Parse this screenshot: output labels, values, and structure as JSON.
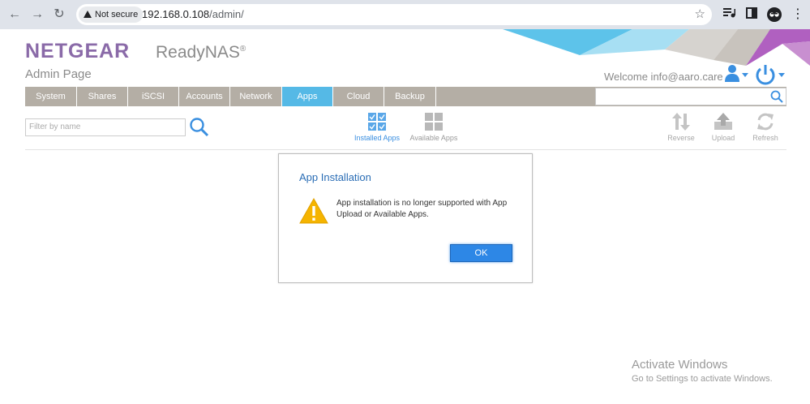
{
  "browser": {
    "back_glyph": "←",
    "forward_glyph": "→",
    "reload_glyph": "↻",
    "security_label": "Not secure",
    "url_host": "192.168.0.108",
    "url_path": "/admin/",
    "star_glyph": "☆",
    "menu_glyph": "⋮",
    "icons": [
      "back-icon",
      "forward-icon",
      "reload-icon",
      "warning-icon",
      "bookmark-star-icon",
      "media-control-icon",
      "side-panel-icon",
      "profile-icon",
      "menu-icon"
    ]
  },
  "header": {
    "logo": "NETGEAR",
    "product": "ReadyNAS",
    "product_mark": "®",
    "subtitle": "Admin Page",
    "welcome": "Welcome info@aaro.care"
  },
  "tabs": [
    {
      "label": "System"
    },
    {
      "label": "Shares"
    },
    {
      "label": "iSCSI"
    },
    {
      "label": "Accounts"
    },
    {
      "label": "Network"
    },
    {
      "label": "Apps"
    },
    {
      "label": "Cloud"
    },
    {
      "label": "Backup"
    }
  ],
  "active_tab": "Apps",
  "search": {
    "value": "",
    "placeholder": ""
  },
  "filter": {
    "placeholder": "Filter by name"
  },
  "views": {
    "installed": "Installed Apps",
    "available": "Available Apps"
  },
  "actions": {
    "reverse": "Reverse",
    "upload": "Upload",
    "refresh": "Refresh"
  },
  "dialog": {
    "title": "App Installation",
    "message": "App installation is no longer supported with App Upload or Available Apps.",
    "ok": "OK"
  },
  "watermark": {
    "title": "Activate Windows",
    "subtitle": "Go to Settings to activate Windows."
  },
  "colors": {
    "brand": "#8a6aa8",
    "tab_bar": "#b4aea5",
    "tab_active": "#55b9e6",
    "accent_blue": "#3a8fe0",
    "ok_button": "#2d87e6",
    "warning": "#f5b400"
  }
}
